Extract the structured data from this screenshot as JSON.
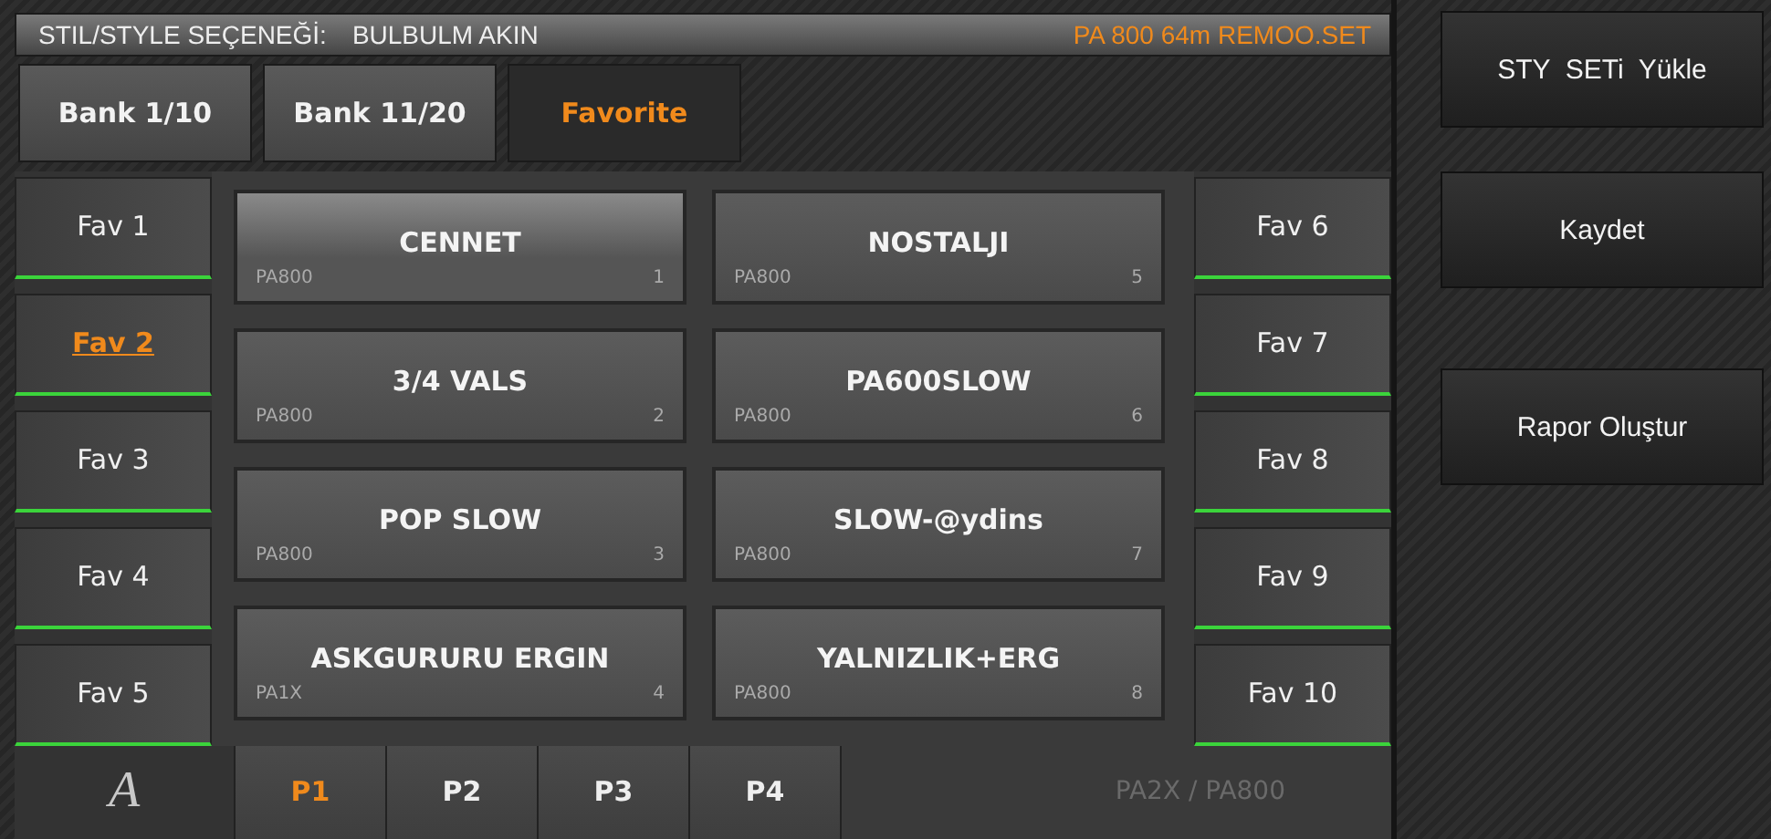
{
  "header": {
    "label": "STIL/STYLE SEÇENEĞİ:",
    "style_name": "BULBULM AKIN",
    "set_name": "PA 800 64m REMOO.SET"
  },
  "bank_tabs": [
    {
      "label": "Bank 1/10",
      "selected": false
    },
    {
      "label": "Bank 11/20",
      "selected": false
    },
    {
      "label": "Favorite",
      "selected": true
    }
  ],
  "favorites_left": [
    {
      "label": "Fav 1",
      "selected": false
    },
    {
      "label": "Fav 2",
      "selected": true
    },
    {
      "label": "Fav 3",
      "selected": false
    },
    {
      "label": "Fav 4",
      "selected": false
    },
    {
      "label": "Fav 5",
      "selected": false
    }
  ],
  "styles": [
    {
      "name": "CENNET",
      "model": "PA800",
      "number": "1",
      "selected": true
    },
    {
      "name": "3/4 VALS",
      "model": "PA800",
      "number": "2",
      "selected": false
    },
    {
      "name": "POP SLOW",
      "model": "PA800",
      "number": "3",
      "selected": false
    },
    {
      "name": "ASKGURURU ERGIN",
      "model": "PA1X",
      "number": "4",
      "selected": false
    },
    {
      "name": "NOSTALJI",
      "model": "PA800",
      "number": "5",
      "selected": false
    },
    {
      "name": "PA600SLOW",
      "model": "PA800",
      "number": "6",
      "selected": false
    },
    {
      "name": "SLOW-@ydins",
      "model": "PA800",
      "number": "7",
      "selected": false
    },
    {
      "name": "YALNIZLIK+ERG",
      "model": "PA800",
      "number": "8",
      "selected": false
    }
  ],
  "favorites_right": [
    {
      "label": "Fav 6",
      "selected": false
    },
    {
      "label": "Fav 7",
      "selected": false
    },
    {
      "label": "Fav 8",
      "selected": false
    },
    {
      "label": "Fav 9",
      "selected": false
    },
    {
      "label": "Fav 10",
      "selected": false
    }
  ],
  "footer": {
    "logo": "A",
    "pages": [
      {
        "label": "P1",
        "selected": true
      },
      {
        "label": "P2",
        "selected": false
      },
      {
        "label": "P3",
        "selected": false
      },
      {
        "label": "P4",
        "selected": false
      }
    ],
    "models": "PA2X / PA800"
  },
  "actions": [
    "STY  SETi  Yükle",
    "Kaydet",
    "Rapor Oluştur"
  ]
}
